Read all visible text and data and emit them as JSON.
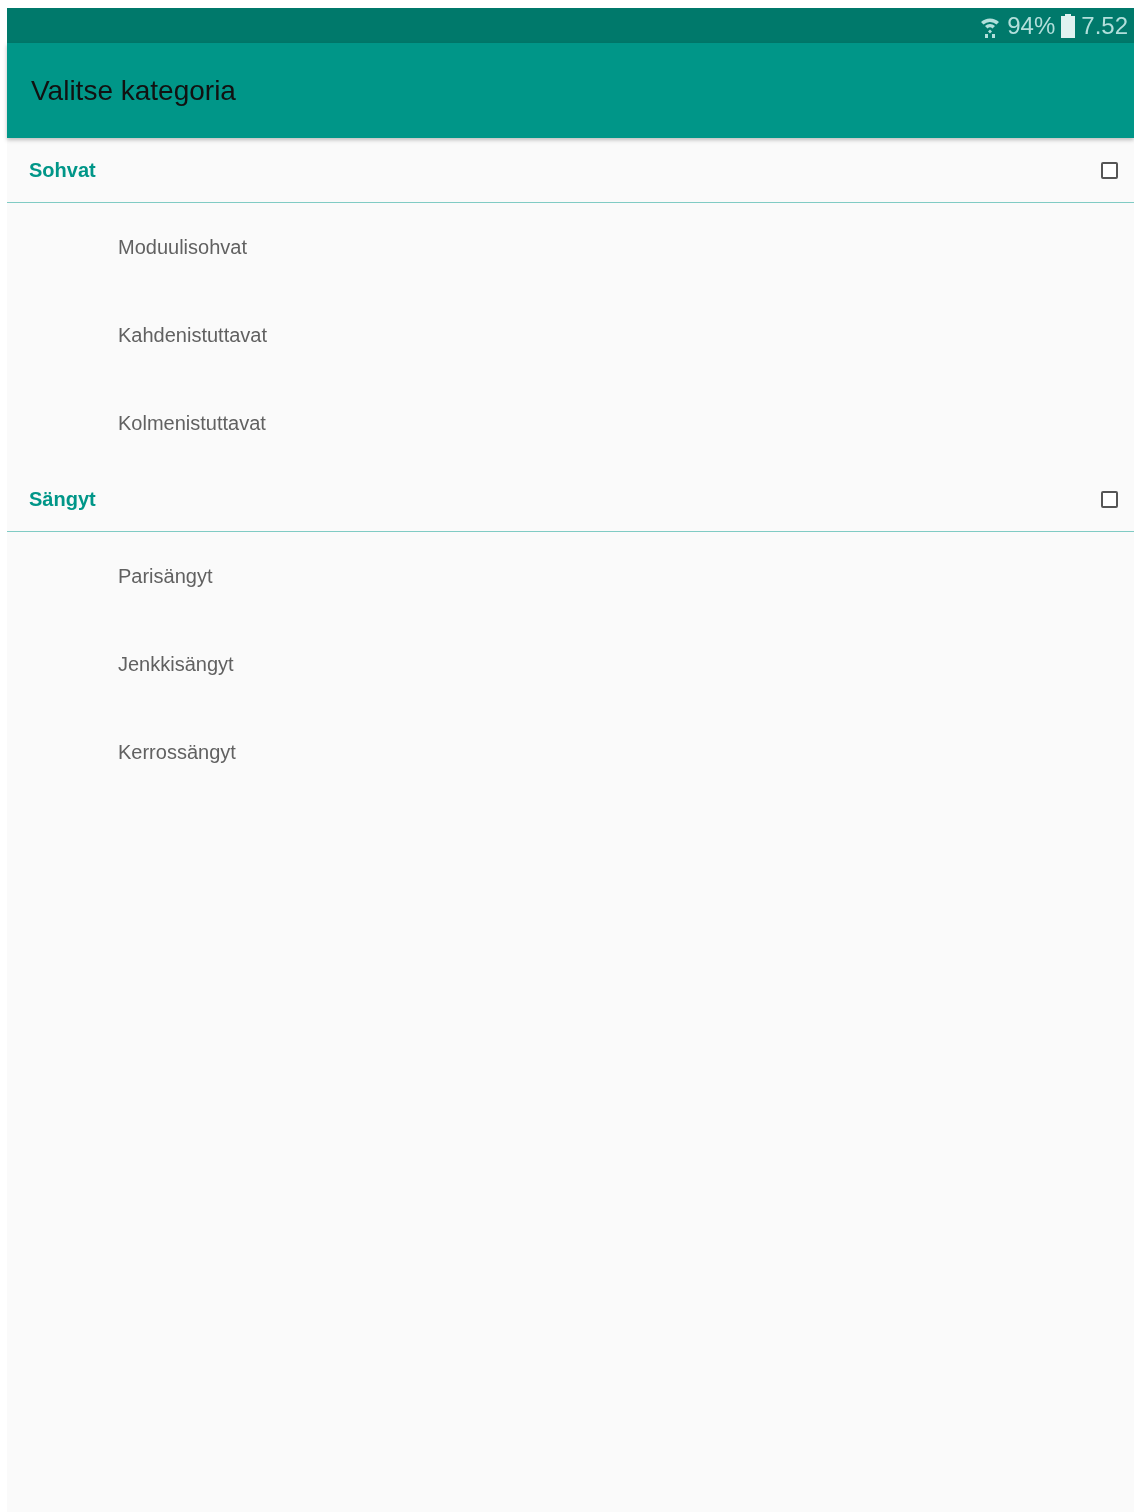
{
  "status_bar": {
    "battery": "94%",
    "time": "7.52"
  },
  "app_bar": {
    "title": "Valitse kategoria"
  },
  "groups": [
    {
      "title": "Sohvat",
      "checked": false,
      "items": [
        "Moduulisohvat",
        "Kahdenistuttavat",
        "Kolmenistuttavat"
      ]
    },
    {
      "title": "Sängyt",
      "checked": false,
      "items": [
        "Parisängyt",
        "Jenkkisängyt",
        "Kerrossängyt"
      ]
    }
  ]
}
